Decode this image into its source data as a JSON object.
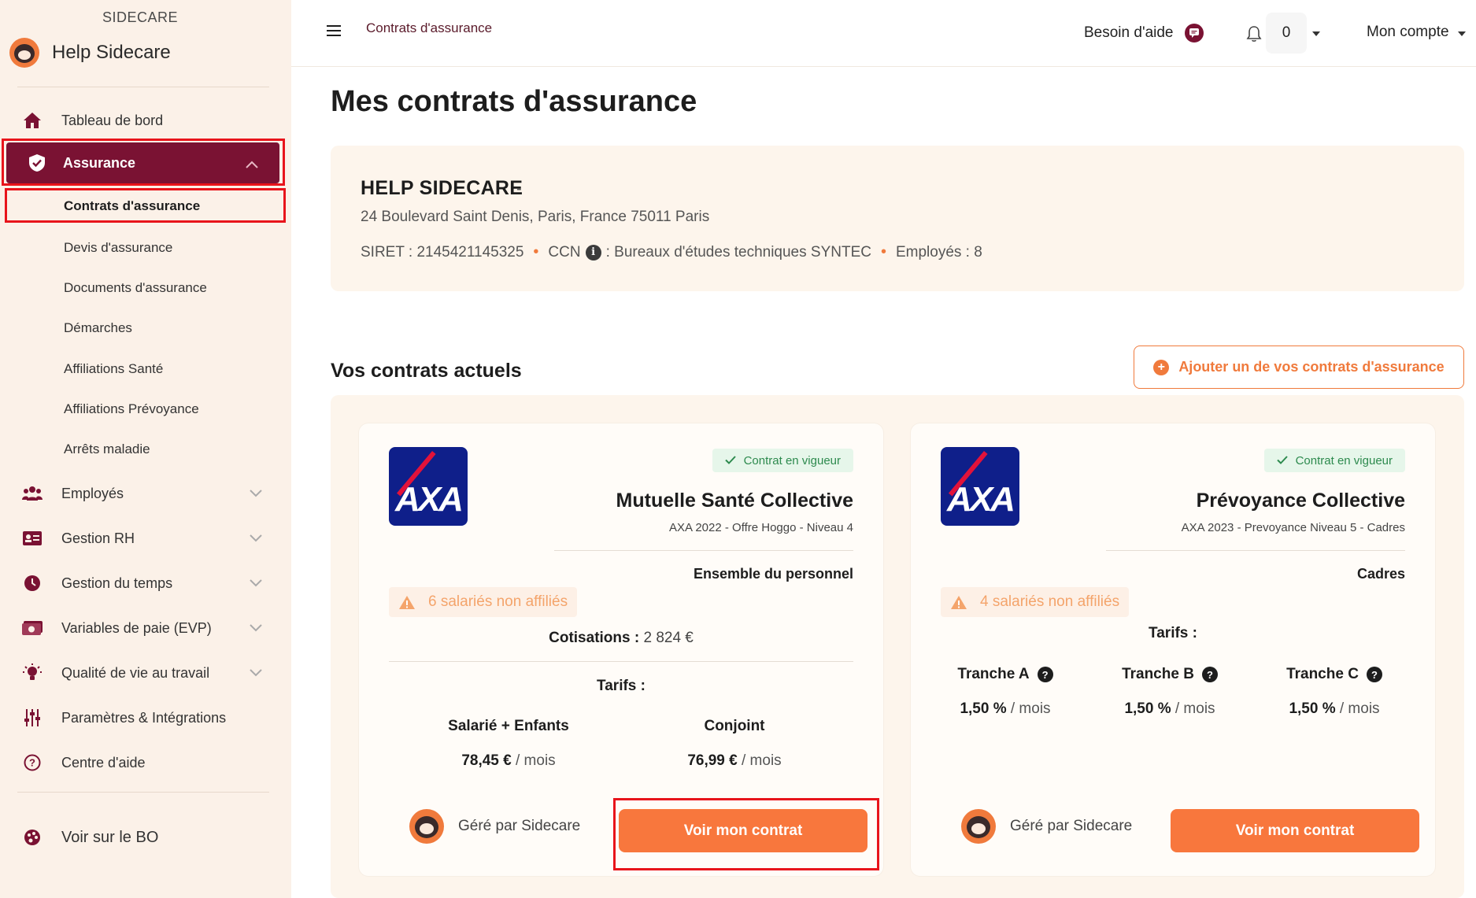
{
  "sidebar": {
    "brand_top": "SIDECARE",
    "brand_name": "Help Sidecare",
    "items": [
      {
        "label": "Tableau de bord",
        "icon": "home-icon"
      },
      {
        "label": "Assurance",
        "icon": "shield-icon"
      },
      {
        "label": "Employés",
        "icon": "users-icon"
      },
      {
        "label": "Gestion RH",
        "icon": "id-card-icon"
      },
      {
        "label": "Gestion du temps",
        "icon": "clock-icon"
      },
      {
        "label": "Variables de paie (EVP)",
        "icon": "money-icon"
      },
      {
        "label": "Qualité de vie au travail",
        "icon": "lightbulb-icon"
      },
      {
        "label": "Paramètres & Intégrations",
        "icon": "sliders-icon"
      },
      {
        "label": "Centre d'aide",
        "icon": "help-circle-icon"
      }
    ],
    "sub_items": [
      "Contrats d'assurance",
      "Devis d'assurance",
      "Documents d'assurance",
      "Démarches",
      "Affiliations Santé",
      "Affiliations Prévoyance",
      "Arrêts maladie"
    ],
    "bottom_item": {
      "label": "Voir sur le BO",
      "icon": "palette-icon"
    }
  },
  "topbar": {
    "breadcrumb": "Contrats d'assurance",
    "help_label": "Besoin d'aide",
    "notification_count": "0",
    "account_label": "Mon compte"
  },
  "main": {
    "page_title": "Mes contrats d'assurance",
    "company": {
      "name": "HELP SIDECARE",
      "dash": "-",
      "address": "24 Boulevard Saint Denis, Paris, France 75011 Paris",
      "siret": "SIRET : 2145421145325",
      "ccn_label": "CCN",
      "ccn_value": ": Bureaux d'études techniques SYNTEC",
      "employees": "Employés : 8"
    },
    "section_title": "Vos contrats actuels",
    "add_button": "Ajouter un de vos contrats d'assurance",
    "contracts": [
      {
        "logo": "AXA",
        "status": "Contrat en vigueur",
        "title": "Mutuelle Santé Collective",
        "subtitle": "AXA 2022 - Offre Hoggo - Niveau 4",
        "population": "Ensemble du personnel",
        "warning": "6 salariés non affiliés",
        "cotisations_label": "Cotisations :",
        "cotisations_value": "2 824 €",
        "tarifs_label": "Tarifs :",
        "tarifs": [
          {
            "name": "Salarié + Enfants",
            "value": "78,45 €",
            "unit": "/ mois"
          },
          {
            "name": "Conjoint",
            "value": "76,99 €",
            "unit": "/ mois"
          }
        ],
        "managed_by": "Géré par Sidecare",
        "button": "Voir mon contrat"
      },
      {
        "logo": "AXA",
        "status": "Contrat en vigueur",
        "title": "Prévoyance Collective",
        "subtitle": "AXA 2023 - Prevoyance Niveau 5 - Cadres",
        "population": "Cadres",
        "warning": "4 salariés non affiliés",
        "tarifs_label": "Tarifs :",
        "tarifs": [
          {
            "name": "Tranche A",
            "value": "1,50 %",
            "unit": "/ mois"
          },
          {
            "name": "Tranche B",
            "value": "1,50 %",
            "unit": "/ mois"
          },
          {
            "name": "Tranche C",
            "value": "1,50 %",
            "unit": "/ mois"
          }
        ],
        "managed_by": "Géré par Sidecare",
        "button": "Voir mon contrat"
      }
    ]
  },
  "colors": {
    "brand_primary": "#7a1233",
    "accent_orange": "#f8773d",
    "sidebar_bg": "#fbf1e8",
    "highlight_red": "#e8141b",
    "status_green": "#2d8a4e"
  }
}
